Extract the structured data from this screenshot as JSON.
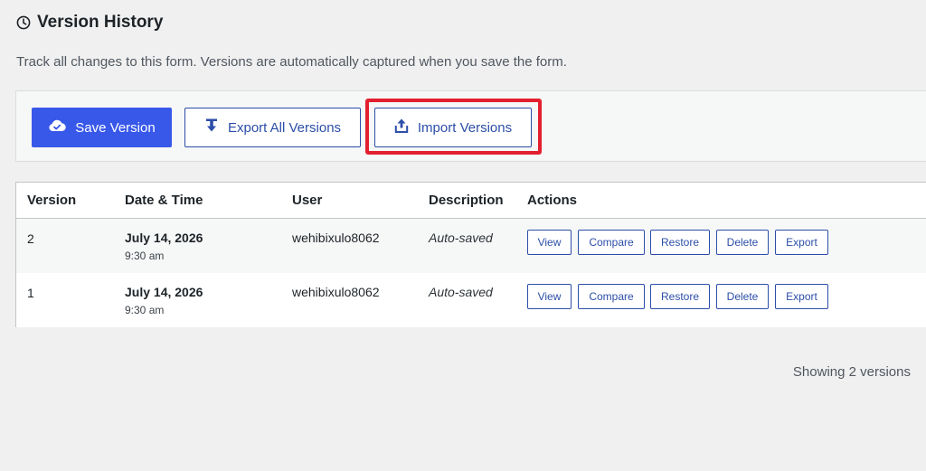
{
  "header": {
    "title": "Version History",
    "description": "Track all changes to this form. Versions are automatically captured when you save the form."
  },
  "toolbar": {
    "save_label": "Save Version",
    "export_all_label": "Export All Versions",
    "import_label": "Import Versions"
  },
  "table": {
    "columns": [
      "Version",
      "Date & Time",
      "User",
      "Description",
      "Actions"
    ],
    "rows": [
      {
        "version": "2",
        "date": "July 14, 2026",
        "time": "9:30 am",
        "user": "wehibixulo8062",
        "description": "Auto-saved"
      },
      {
        "version": "1",
        "date": "July 14, 2026",
        "time": "9:30 am",
        "user": "wehibixulo8062",
        "description": "Auto-saved"
      }
    ],
    "actions": {
      "view": "View",
      "compare": "Compare",
      "restore": "Restore",
      "delete": "Delete",
      "export": "Export"
    }
  },
  "footer": {
    "count_text": "Showing 2 versions"
  },
  "icons": {
    "header": "clock-icon",
    "save": "cloud-check-icon",
    "export_all": "download-icon",
    "import": "upload-icon"
  },
  "colors": {
    "primary": "#3858e9",
    "outline": "#2c4ea8",
    "highlight": "#e3202f",
    "background": "#f0f0f1"
  }
}
